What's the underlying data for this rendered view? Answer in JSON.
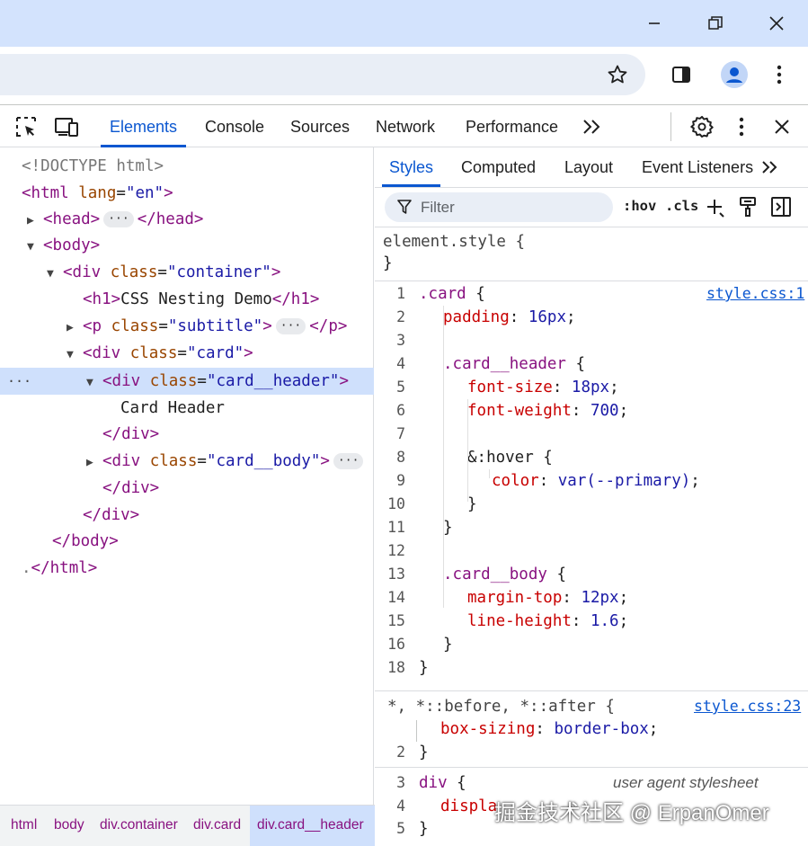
{
  "devtools": {
    "tabs": [
      "Elements",
      "Console",
      "Sources",
      "Network",
      "Performance"
    ],
    "active_tab": "Elements"
  },
  "dom_tree": {
    "doctype": "<!DOCTYPE html>",
    "html_open": "<html",
    "lang_attr": "lang",
    "lang_val": "\"en\"",
    "head_open": "<head>",
    "head_close": "</head>",
    "body_open": "<body>",
    "div_open": "<div",
    "class_attr": "class",
    "container_val": "\"container\"",
    "h1_open": "<h1>",
    "h1_text": "CSS Nesting Demo",
    "h1_close": "</h1>",
    "p_open": "<p",
    "subtitle_val": "\"subtitle\"",
    "p_close": "</p>",
    "card_val": "\"card\"",
    "card_header_val": "\"card__header\"",
    "card_header_text": "Card Header",
    "div_close": "</div>",
    "card_body_val": "\"card__body\"",
    "body_close": "</body>",
    "html_close": "</html>",
    "gt": ">"
  },
  "breadcrumb": [
    "html",
    "body",
    "div.container",
    "div.card",
    "div.card__header"
  ],
  "styles_tabs": [
    "Styles",
    "Computed",
    "Layout",
    "Event Listeners"
  ],
  "filter": {
    "placeholder": "Filter",
    "hov": ":hov",
    "cls": ".cls"
  },
  "styles": {
    "element_style": "element.style {",
    "close_brace": "}",
    "source1": "style.css:1",
    "source2": "style.css:23",
    "user_agent": "user agent stylesheet",
    "rule1": [
      {
        "n": "1",
        "indent": 0,
        "parts": [
          [
            "sel",
            ".card"
          ],
          [
            "pun",
            " {"
          ]
        ]
      },
      {
        "n": "2",
        "indent": 1,
        "parts": [
          [
            "prop",
            "padding"
          ],
          [
            "pun",
            ": "
          ],
          [
            "pv",
            "16px"
          ],
          [
            "pun",
            ";"
          ]
        ]
      },
      {
        "n": "3",
        "indent": 0,
        "parts": []
      },
      {
        "n": "4",
        "indent": 1,
        "parts": [
          [
            "sel",
            ".card__header"
          ],
          [
            "pun",
            " {"
          ]
        ]
      },
      {
        "n": "5",
        "indent": 2,
        "parts": [
          [
            "prop",
            "font-size"
          ],
          [
            "pun",
            ": "
          ],
          [
            "pv",
            "18px"
          ],
          [
            "pun",
            ";"
          ]
        ]
      },
      {
        "n": "6",
        "indent": 2,
        "parts": [
          [
            "prop",
            "font-weight"
          ],
          [
            "pun",
            ": "
          ],
          [
            "pv",
            "700"
          ],
          [
            "pun",
            ";"
          ]
        ]
      },
      {
        "n": "7",
        "indent": 0,
        "parts": []
      },
      {
        "n": "8",
        "indent": 2,
        "parts": [
          [
            "pun",
            "&:hover {"
          ]
        ]
      },
      {
        "n": "9",
        "indent": 3,
        "parts": [
          [
            "prop",
            "color"
          ],
          [
            "pun",
            ": "
          ],
          [
            "pv",
            "var(--primary)"
          ],
          [
            "pun",
            ";"
          ]
        ]
      },
      {
        "n": "10",
        "indent": 2,
        "parts": [
          [
            "pun",
            "}"
          ]
        ]
      },
      {
        "n": "11",
        "indent": 1,
        "parts": [
          [
            "pun",
            "}"
          ]
        ]
      },
      {
        "n": "12",
        "indent": 0,
        "parts": []
      },
      {
        "n": "13",
        "indent": 1,
        "parts": [
          [
            "sel",
            ".card__body"
          ],
          [
            "pun",
            " {"
          ]
        ]
      },
      {
        "n": "14",
        "indent": 2,
        "parts": [
          [
            "prop",
            "margin-top"
          ],
          [
            "pun",
            ": "
          ],
          [
            "pv",
            "12px"
          ],
          [
            "pun",
            ";"
          ]
        ]
      },
      {
        "n": "15",
        "indent": 2,
        "parts": [
          [
            "prop",
            "line-height"
          ],
          [
            "pun",
            ": "
          ],
          [
            "pv",
            "1.6"
          ],
          [
            "pun",
            ";"
          ]
        ]
      },
      {
        "n": "16",
        "indent": 1,
        "parts": [
          [
            "pun",
            "}"
          ]
        ]
      },
      {
        "n": "18",
        "indent": 0,
        "parts": [
          [
            "pun",
            "}"
          ]
        ]
      }
    ],
    "rule2_selector": "*, *::before, *::after {",
    "rule2_prop": "box-sizing",
    "rule2_val": "border-box",
    "rule2_close_n": "2",
    "rule3_n1": "3",
    "rule3_selector": "div",
    "rule3_n2": "4",
    "rule3_prop": "displa",
    "rule3_n3": "5"
  },
  "watermark": "掘金技术社区 @ ErpanOmer",
  "colors": {
    "accent": "#0b57d0",
    "titlebar": "#d3e3fd",
    "selection": "#cfe0fc"
  }
}
